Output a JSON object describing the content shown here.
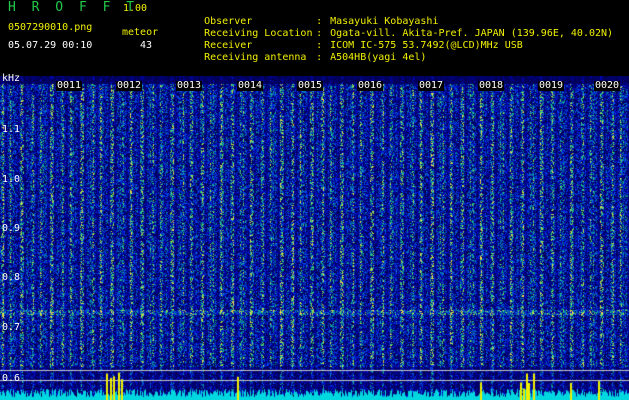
{
  "app": {
    "title": "H R O F F T",
    "version": "1.00"
  },
  "meta": {
    "filename": "0507290010.png",
    "datetime": "05.07.29 00:10",
    "meteor_label": "meteor",
    "meteor_count": "43"
  },
  "info": [
    {
      "label": "Observer",
      "value": "Masayuki Kobayashi"
    },
    {
      "label": "Receiving Location",
      "value": "Ogata-vill. Akita-Pref. JAPAN (139.96E, 40.02N)"
    },
    {
      "label": "Receiver",
      "value": "ICOM IC-575 53.7492(@LCD)MHz USB"
    },
    {
      "label": "Receiving antenna",
      "value": "A504HB(yagi 4el)"
    }
  ],
  "info_separator": ":",
  "axis": {
    "unit": "kHz",
    "y_ticks": [
      "1.1",
      "1.0",
      "0.9",
      "0.8",
      "0.7",
      "0.6"
    ],
    "minute_labels": [
      "0011",
      "0012",
      "0013",
      "0014",
      "0015",
      "0016",
      "0017",
      "0018",
      "0019",
      "0020"
    ]
  },
  "colors": {
    "background": "#000000",
    "header_green": "#22c84a",
    "header_yellow": "#f0f000",
    "noise_base": "#001a8a",
    "activity_bar": "#00d8e0",
    "activity_peak": "#f0f000"
  }
}
